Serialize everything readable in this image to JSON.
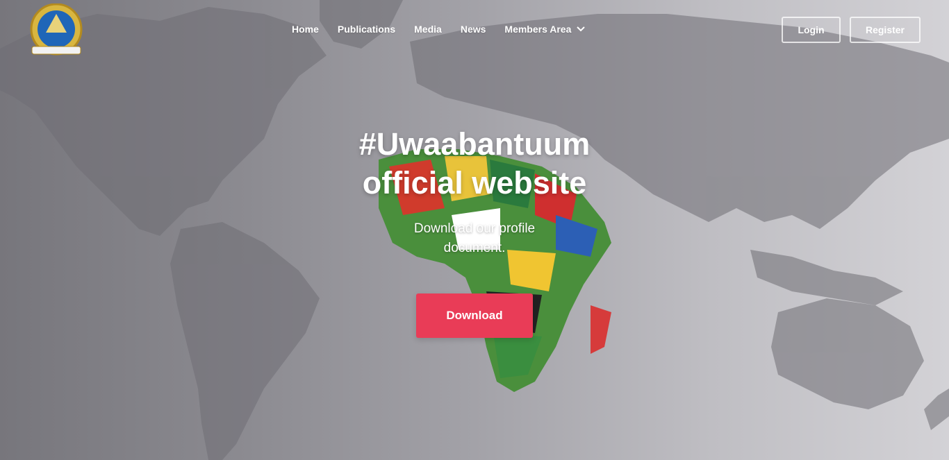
{
  "header": {
    "logo_icon": "abantuum-emblem-icon",
    "nav": [
      {
        "label": "Home"
      },
      {
        "label": "Publications"
      },
      {
        "label": "Media"
      },
      {
        "label": "News"
      },
      {
        "label": "Members Area",
        "has_dropdown": true
      }
    ],
    "login_label": "Login",
    "register_label": "Register"
  },
  "hero": {
    "title_line1": "#Uwaabantuum",
    "title_line2": "official website",
    "subtitle_line1": "Download our profile",
    "subtitle_line2": "document.",
    "download_label": "Download",
    "background_icon": "world-map-africa-flags-icon"
  },
  "colors": {
    "accent": "#e93c57",
    "text": "#ffffff",
    "map_land": "#8f8e94"
  }
}
